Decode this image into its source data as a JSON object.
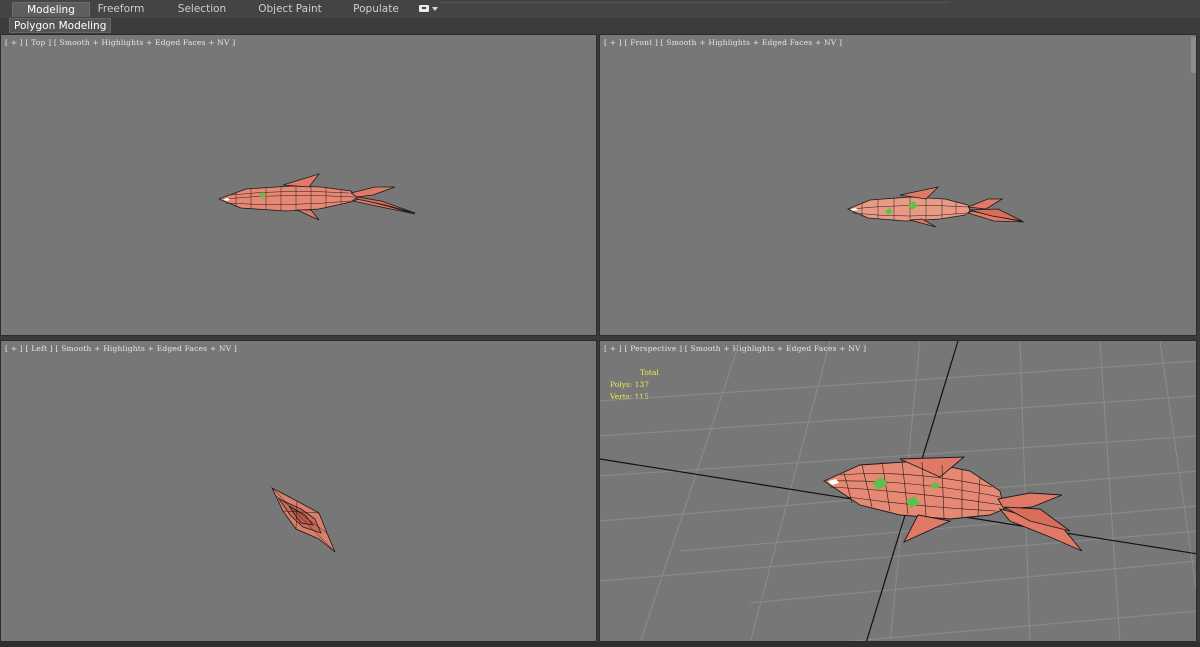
{
  "ribbon": {
    "tabs": [
      {
        "label": "Modeling",
        "active": true
      },
      {
        "label": "Freeform",
        "active": false
      },
      {
        "label": "Selection",
        "active": false
      },
      {
        "label": "Object Paint",
        "active": false
      },
      {
        "label": "Populate",
        "active": false
      }
    ],
    "panel_label": "Polygon Modeling",
    "menu_icon": "menu-dropdown-icon"
  },
  "viewports": {
    "top": {
      "label": "[ + ] [ Top ] [ Smooth + Highlights + Edged Faces + NV ]"
    },
    "front": {
      "label": "[ + ] [ Front ] [ Smooth + Highlights + Edged Faces + NV ]"
    },
    "left": {
      "label": "[ + ] [ Left ] [ Smooth + Highlights + Edged Faces + NV ]"
    },
    "perspective": {
      "label": "[ + ] [ Perspective ] [ Smooth + Highlights + Edged Faces + NV ]",
      "stats": {
        "total_label": "Total",
        "polys": "Polys: 137",
        "verts": "Verts: 115"
      }
    }
  },
  "colors": {
    "viewport_bg": "#777777",
    "mesh_fill": "#e07a66",
    "mesh_edge": "#1a1a1a",
    "stats_text": "#f0e84a"
  }
}
